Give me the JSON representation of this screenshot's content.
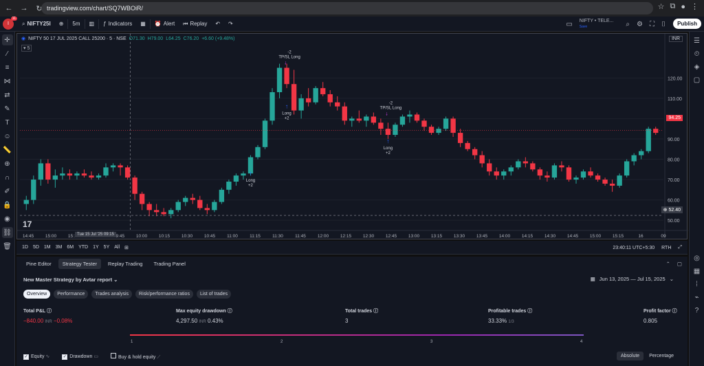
{
  "browser": {
    "url": "tradingview.com/chart/SQ7WBOiR/"
  },
  "header": {
    "notification_count": "11",
    "symbol": "NIFTY25I",
    "interval": "5m",
    "indicators_label": "Indicators",
    "alert_label": "Alert",
    "replay_label": "Replay",
    "watchlist_name": "NIFTY • TELE...",
    "watchlist_sub": "Save",
    "publish_label": "Publish"
  },
  "chart": {
    "instrument": "NIFTY 50 17 JUL 2025 CALL 25200 · 5 · NSE",
    "ohlc": {
      "o": "O71.30",
      "h": "H79.00",
      "l": "L64.25",
      "c": "C76.20",
      "chg": "+6.60 (+9.48%)"
    },
    "legend_row2": "5",
    "currency": "INR",
    "current_price": "94.25",
    "crosshair_price": "52.40",
    "crosshair_time": "Tue 15 Jul '25   09:15",
    "watermark": "17",
    "marker_labels": {
      "long": "Long",
      "plus2": "+2",
      "minus2": "-2",
      "tpsl": "TP/SL Long"
    },
    "time_ticks": [
      "14:45",
      "15:00",
      "15:15",
      "15",
      "09:45",
      "10:00",
      "10:15",
      "10:30",
      "10:45",
      "11:00",
      "11:15",
      "11:30",
      "11:45",
      "12:00",
      "12:15",
      "12:30",
      "12:45",
      "13:00",
      "13:15",
      "13:30",
      "13:45",
      "14:00",
      "14:15",
      "14:30",
      "14:45",
      "15:00",
      "15:15",
      "16",
      "09"
    ]
  },
  "chart_data": {
    "type": "candlestick",
    "yticks": [
      120,
      110,
      100,
      90,
      80,
      70,
      60,
      50
    ],
    "ylim": [
      47,
      135
    ],
    "x": [
      "14:45",
      "",
      "",
      "",
      "15:00",
      "",
      "",
      "",
      "",
      "15:15",
      "",
      "",
      "",
      "",
      "15",
      "",
      "",
      "",
      "09:45",
      "",
      "",
      "10:00",
      "",
      "",
      "10:15",
      "",
      "",
      "10:30",
      "",
      "",
      "10:45",
      "",
      "",
      "11:00",
      "",
      "",
      "11:15",
      "",
      "",
      "11:30",
      "",
      "",
      "11:45",
      "",
      "",
      "12:00",
      "",
      "",
      "12:15",
      "",
      "",
      "12:30",
      "",
      "",
      "12:45",
      "",
      "",
      "13:00",
      "",
      "",
      "13:15",
      "",
      "",
      "13:30",
      "",
      "",
      "13:45",
      "",
      "",
      "14:00",
      "",
      "",
      "14:15",
      "",
      "",
      "14:30",
      "",
      "",
      "14:45",
      "",
      "",
      "15:00",
      "",
      "",
      "15:15"
    ],
    "ohlc": [
      [
        58,
        62,
        55,
        60
      ],
      [
        60,
        72,
        58,
        70
      ],
      [
        70,
        80,
        67,
        78
      ],
      [
        78,
        80,
        68,
        70
      ],
      [
        70,
        75,
        66,
        72
      ],
      [
        72,
        76,
        70,
        73
      ],
      [
        73,
        75,
        70,
        72
      ],
      [
        72,
        74,
        70,
        73
      ],
      [
        73,
        75,
        71,
        72
      ],
      [
        72,
        74,
        70,
        71
      ],
      [
        71,
        73,
        70,
        72
      ],
      [
        72,
        78,
        71,
        76
      ],
      [
        76,
        78,
        74,
        77
      ],
      [
        77,
        78,
        72,
        76
      ],
      [
        76,
        77,
        70,
        71
      ],
      [
        71,
        72,
        60,
        63
      ],
      [
        63,
        64,
        55,
        58
      ],
      [
        58,
        59,
        52,
        55
      ],
      [
        55,
        58,
        52,
        54
      ],
      [
        54,
        56,
        52,
        53
      ],
      [
        53,
        56,
        51,
        55
      ],
      [
        55,
        60,
        54,
        59
      ],
      [
        59,
        62,
        57,
        61
      ],
      [
        61,
        63,
        58,
        60
      ],
      [
        60,
        62,
        55,
        56
      ],
      [
        56,
        58,
        53,
        55
      ],
      [
        55,
        60,
        54,
        59
      ],
      [
        59,
        66,
        58,
        65
      ],
      [
        65,
        70,
        63,
        69
      ],
      [
        69,
        73,
        67,
        72
      ],
      [
        72,
        74,
        70,
        73
      ],
      [
        73,
        82,
        72,
        81
      ],
      [
        81,
        87,
        80,
        86
      ],
      [
        86,
        100,
        85,
        99
      ],
      [
        99,
        115,
        97,
        113
      ],
      [
        113,
        127,
        110,
        125
      ],
      [
        125,
        127,
        115,
        117
      ],
      [
        117,
        124,
        102,
        104
      ],
      [
        104,
        112,
        100,
        110
      ],
      [
        110,
        115,
        106,
        108
      ],
      [
        108,
        116,
        107,
        115
      ],
      [
        115,
        118,
        111,
        112
      ],
      [
        112,
        114,
        106,
        108
      ],
      [
        108,
        111,
        104,
        106
      ],
      [
        106,
        108,
        97,
        99
      ],
      [
        99,
        101,
        96,
        100
      ],
      [
        100,
        104,
        98,
        99
      ],
      [
        99,
        102,
        96,
        101
      ],
      [
        101,
        103,
        97,
        98
      ],
      [
        98,
        100,
        92,
        95
      ],
      [
        95,
        98,
        90,
        92
      ],
      [
        92,
        98,
        91,
        97
      ],
      [
        97,
        102,
        96,
        101
      ],
      [
        101,
        104,
        98,
        102
      ],
      [
        102,
        103,
        98,
        99
      ],
      [
        99,
        100,
        94,
        96
      ],
      [
        96,
        97,
        92,
        93
      ],
      [
        93,
        96,
        92,
        95
      ],
      [
        95,
        101,
        94,
        100
      ],
      [
        100,
        101,
        91,
        93
      ],
      [
        93,
        95,
        86,
        88
      ],
      [
        88,
        89,
        84,
        85
      ],
      [
        85,
        86,
        80,
        82
      ],
      [
        82,
        84,
        76,
        78
      ],
      [
        78,
        80,
        72,
        74
      ],
      [
        74,
        76,
        70,
        72
      ],
      [
        72,
        75,
        70,
        74
      ],
      [
        74,
        77,
        72,
        76
      ],
      [
        76,
        80,
        75,
        79
      ],
      [
        79,
        81,
        76,
        78
      ],
      [
        78,
        79,
        74,
        75
      ],
      [
        75,
        76,
        70,
        72
      ],
      [
        72,
        74,
        69,
        71
      ],
      [
        71,
        78,
        70,
        77
      ],
      [
        77,
        79,
        74,
        76
      ],
      [
        76,
        77,
        69,
        70
      ],
      [
        70,
        72,
        68,
        71
      ],
      [
        71,
        75,
        70,
        74
      ],
      [
        74,
        76,
        71,
        72
      ],
      [
        72,
        73,
        69,
        70
      ],
      [
        70,
        71,
        67,
        68
      ],
      [
        68,
        70,
        64,
        67
      ],
      [
        67,
        73,
        66,
        72
      ],
      [
        72,
        80,
        71,
        79
      ],
      [
        79,
        83,
        77,
        82
      ],
      [
        82,
        85,
        80,
        84
      ],
      [
        84,
        96,
        83,
        95
      ],
      [
        95,
        96,
        92,
        93
      ]
    ],
    "annotations": [
      "Long +2",
      "-2 TP/SL Long"
    ]
  },
  "bottom_toolbar": {
    "ranges": [
      "1D",
      "5D",
      "1M",
      "3M",
      "6M",
      "YTD",
      "1Y",
      "5Y",
      "All"
    ],
    "clock": "23:40:11 UTC+5:30",
    "rth": "RTH"
  },
  "panel": {
    "tabs": [
      "Pine Editor",
      "Strategy Tester",
      "Replay Trading",
      "Trading Panel"
    ],
    "strategy_name": "New Master Strategy by Avtar report",
    "date_range": "Jun 13, 2025 — Jul 15, 2025",
    "pills": [
      "Overview",
      "Performance",
      "Trades analysis",
      "Risk/performance ratios",
      "List of trades"
    ],
    "metrics": {
      "total_pnl_label": "Total P&L",
      "total_pnl_value": "−840.00",
      "total_pnl_unit": "INR",
      "total_pnl_pct": "−0.08%",
      "max_dd_label": "Max equity drawdown",
      "max_dd_value": "4,297.50",
      "max_dd_unit": "INR",
      "max_dd_pct": "0.43%",
      "total_trades_label": "Total trades",
      "total_trades_value": "3",
      "profitable_label": "Profitable trades",
      "profitable_value": "33.33%",
      "profitable_sub": "1/3",
      "pf_label": "Profit factor",
      "pf_value": "0.805"
    },
    "equity_axis": [
      "1",
      "2",
      "3",
      "4"
    ],
    "checkboxes": {
      "equity": "Equity",
      "drawdown": "Drawdown",
      "buyhold": "Buy & hold equity"
    },
    "toggle": {
      "absolute": "Absolute",
      "percentage": "Percentage"
    }
  },
  "colors": {
    "up": "#26a69a",
    "down": "#f23645",
    "bg": "#131722"
  }
}
